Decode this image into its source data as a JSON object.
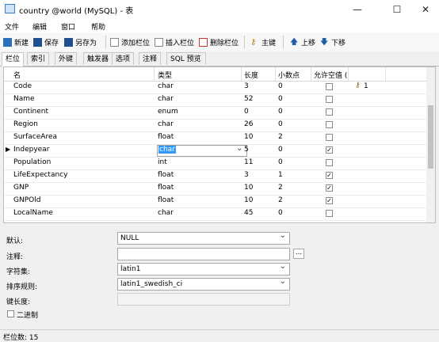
{
  "window": {
    "title": "country @world (MySQL) - 表",
    "minimize": "—",
    "maximize": "☐",
    "close": "✕"
  },
  "menu": [
    "文件",
    "编辑",
    "窗口",
    "帮助"
  ],
  "toolbar": {
    "new": "新建",
    "save": "保存",
    "save_as": "另存为",
    "add_field": "添加栏位",
    "insert_field": "插入栏位",
    "delete_field": "删除栏位",
    "primary_key": "主键",
    "move_up": "上移",
    "move_down": "下移"
  },
  "tabs": [
    "栏位",
    "索引",
    "外键",
    "触发器",
    "选项",
    "注释",
    "SQL 预览"
  ],
  "grid": {
    "columns": {
      "name": "名",
      "type": "类型",
      "length": "长度",
      "decimals": "小数点",
      "allow_null": "允许空值 ("
    },
    "key_label": "1",
    "rows": [
      {
        "name": "Code",
        "type": "char",
        "length": "3",
        "decimals": "0",
        "null": false,
        "key": true
      },
      {
        "name": "Name",
        "type": "char",
        "length": "52",
        "decimals": "0",
        "null": false
      },
      {
        "name": "Continent",
        "type": "enum",
        "length": "0",
        "decimals": "0",
        "null": false
      },
      {
        "name": "Region",
        "type": "char",
        "length": "26",
        "decimals": "0",
        "null": false
      },
      {
        "name": "SurfaceArea",
        "type": "float",
        "length": "10",
        "decimals": "2",
        "null": false
      },
      {
        "name": "Indepyear",
        "type": "char",
        "length": "5",
        "decimals": "0",
        "null": true,
        "editing": true
      },
      {
        "name": "Population",
        "type": "int",
        "length": "11",
        "decimals": "0",
        "null": false
      },
      {
        "name": "LifeExpectancy",
        "type": "float",
        "length": "3",
        "decimals": "1",
        "null": true
      },
      {
        "name": "GNP",
        "type": "float",
        "length": "10",
        "decimals": "2",
        "null": true
      },
      {
        "name": "GNPOld",
        "type": "float",
        "length": "10",
        "decimals": "2",
        "null": true
      },
      {
        "name": "LocalName",
        "type": "char",
        "length": "45",
        "decimals": "0",
        "null": false
      }
    ]
  },
  "props": {
    "default_label": "默认:",
    "default_value": "NULL",
    "comment_label": "注释:",
    "comment_value": "",
    "comment_btn": "...",
    "charset_label": "字符集:",
    "charset_value": "latin1",
    "collation_label": "排序规则:",
    "collation_value": "latin1_swedish_ci",
    "keylen_label": "键长度:",
    "keylen_value": "",
    "binary_label": "二进制"
  },
  "status": {
    "field_count": "栏位数: 15"
  },
  "colors": {
    "selection": "#3399ff",
    "window_bg": "#f0f0f0"
  }
}
